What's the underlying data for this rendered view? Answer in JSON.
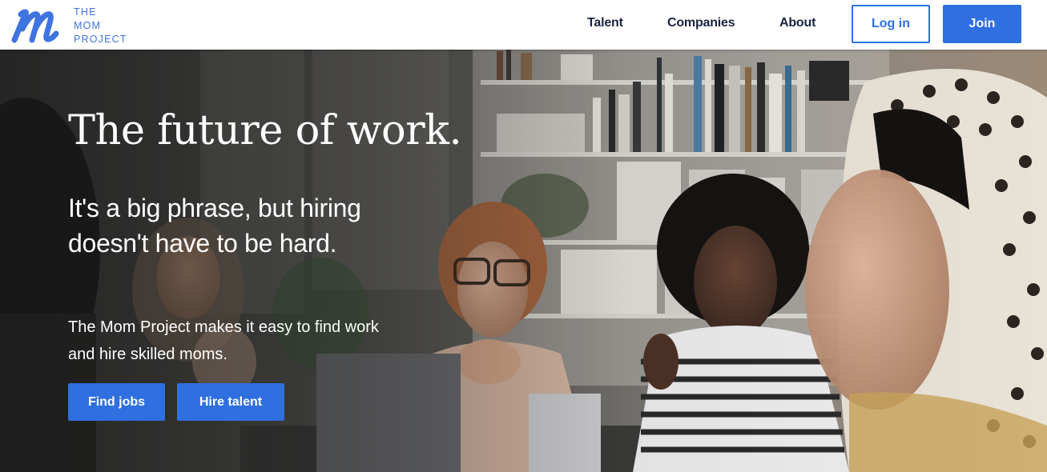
{
  "brand": {
    "logo_lines": [
      "THE",
      "MOM",
      "PROJECT"
    ],
    "color": "#3f73e0"
  },
  "nav": {
    "talent": "Talent",
    "companies": "Companies",
    "about": "About",
    "login": "Log in",
    "join": "Join"
  },
  "hero": {
    "title": "The future of work.",
    "subtitle": "It's a big phrase, but hiring doesn't have to be hard.",
    "text": "The Mom Project makes it easy to find work and hire skilled moms.",
    "find_jobs": "Find jobs",
    "hire_talent": "Hire talent"
  },
  "colors": {
    "primary": "#2f6fe0",
    "nav_text": "#1c2340",
    "hero_text": "#ffffff"
  }
}
